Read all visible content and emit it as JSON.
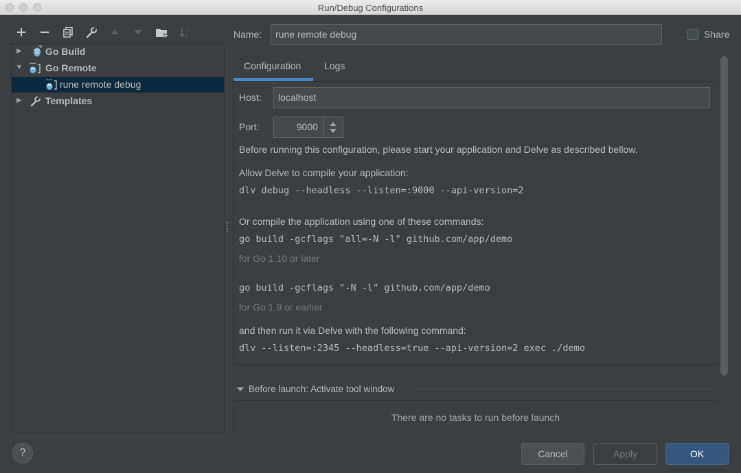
{
  "window": {
    "title": "Run/Debug Configurations"
  },
  "toolbar": {
    "icons": [
      "add-icon",
      "remove-icon",
      "copy-icon",
      "wrench-icon",
      "move-up-icon",
      "move-down-icon",
      "new-folder-icon",
      "sort-icon"
    ]
  },
  "tree": {
    "items": [
      {
        "label": "Go Build",
        "icon": "go-build-icon",
        "expanded": false
      },
      {
        "label": "Go Remote",
        "icon": "go-remote-icon",
        "expanded": true
      },
      {
        "label": "rune remote debug",
        "icon": "go-remote-icon",
        "selected": true
      },
      {
        "label": "Templates",
        "icon": "wrench-icon",
        "expanded": false
      }
    ]
  },
  "name": {
    "label": "Name:",
    "value": "rune remote debug"
  },
  "share": {
    "label": "Share",
    "checked": false
  },
  "tabs": [
    {
      "label": "Configuration",
      "active": true
    },
    {
      "label": "Logs",
      "active": false
    }
  ],
  "config": {
    "host_label": "Host:",
    "host_value": "localhost",
    "port_label": "Port:",
    "port_value": "9000",
    "intro": "Before running this configuration, please start your application and Delve as described bellow.",
    "allow_heading": "Allow Delve to compile your application:",
    "allow_cmd": "dlv debug --headless --listen=:9000 --api-version=2",
    "or_heading": "Or compile the application using one of these commands:",
    "cmd_new": "go build -gcflags \"all=-N -l\" github.com/app/demo",
    "cmd_new_hint": "for Go 1.10 or later",
    "cmd_old": "go build -gcflags \"-N -l\" github.com/app/demo",
    "cmd_old_hint": "for Go 1.9 or earlier",
    "run_heading": "and then run it via Delve with the following command:",
    "run_cmd": "dlv --listen=:2345 --headless=true --api-version=2 exec ./demo"
  },
  "before_launch": {
    "title": "Before launch: Activate tool window",
    "empty": "There are no tasks to run before launch"
  },
  "buttons": {
    "help": "?",
    "cancel": "Cancel",
    "apply": "Apply",
    "ok": "OK"
  },
  "colors": {
    "accent": "#4a88c7",
    "selection": "#0d293e",
    "default_button": "#365880",
    "background": "#3c3f41"
  }
}
